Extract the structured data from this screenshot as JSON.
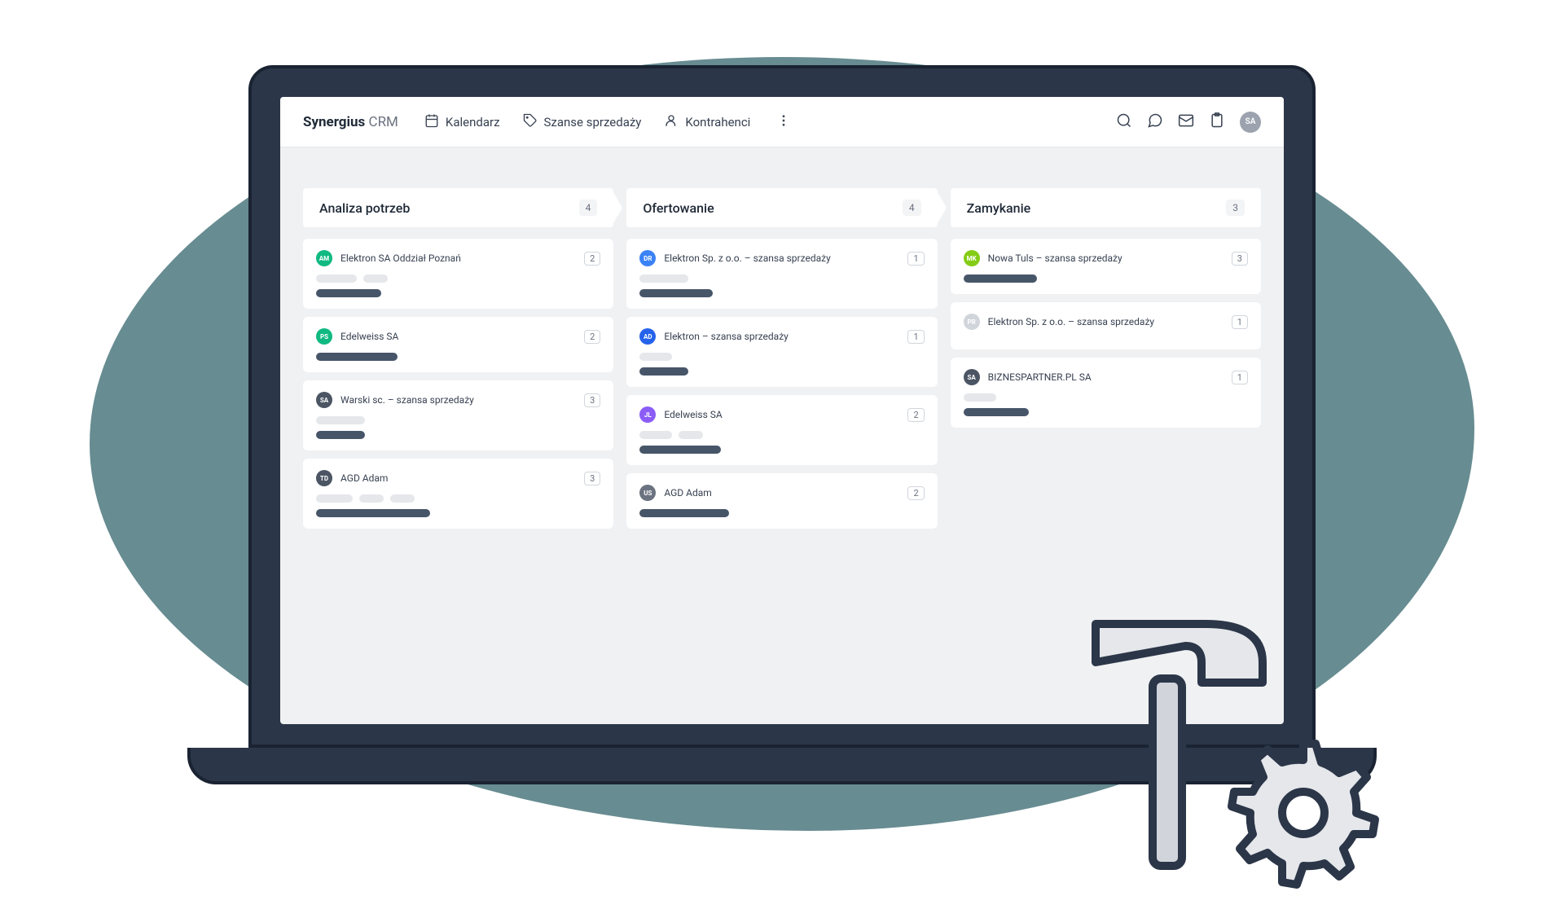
{
  "brand": {
    "name": "Synergius",
    "suffix": "CRM"
  },
  "nav": {
    "calendar": "Kalendarz",
    "opportunities": "Szanse sprzedaży",
    "contractors": "Kontrahenci"
  },
  "user_avatar": "SA",
  "columns": [
    {
      "title": "Analiza potrzeb",
      "count": "4",
      "cards": [
        {
          "avatar": "AM",
          "color": "#10b981",
          "title": "Elektron SA Oddział Poznań",
          "num": "2",
          "ph_light": [
            50,
            30
          ],
          "ph_dark": 80
        },
        {
          "avatar": "PS",
          "color": "#10b981",
          "title": "Edelweiss SA",
          "num": "2",
          "ph_light": [],
          "ph_dark": 100
        },
        {
          "avatar": "SA",
          "color": "#4b5563",
          "title": "Warski sc. – szansa sprzedaży",
          "num": "3",
          "ph_light": [
            60
          ],
          "ph_dark": 60
        },
        {
          "avatar": "TD",
          "color": "#4b5563",
          "title": "AGD Adam",
          "num": "3",
          "ph_light": [
            45,
            30,
            30
          ],
          "ph_dark": 140
        }
      ]
    },
    {
      "title": "Ofertowanie",
      "count": "4",
      "cards": [
        {
          "avatar": "DR",
          "color": "#3b82f6",
          "title": "Elektron Sp. z o.o. – szansa sprzedaży",
          "num": "1",
          "ph_light": [
            60
          ],
          "ph_dark": 90
        },
        {
          "avatar": "AD",
          "color": "#2563eb",
          "title": "Elektron – szansa sprzedaży",
          "num": "1",
          "ph_light": [
            40
          ],
          "ph_dark": 60
        },
        {
          "avatar": "JL",
          "color": "#8b5cf6",
          "title": "Edelweiss SA",
          "num": "2",
          "ph_light": [
            40,
            30
          ],
          "ph_dark": 100
        },
        {
          "avatar": "US",
          "color": "#6b7280",
          "title": "AGD Adam",
          "num": "2",
          "ph_light": [],
          "ph_dark": 110
        }
      ]
    },
    {
      "title": "Zamykanie",
      "count": "3",
      "cards": [
        {
          "avatar": "MK",
          "color": "#84cc16",
          "title": "Nowa Tuls – szansa sprzedaży",
          "num": "3",
          "ph_light": [],
          "ph_dark": 90
        },
        {
          "avatar": "PR",
          "color": "#d1d5db",
          "title": "Elektron Sp. z o.o. – szansa sprzedaży",
          "num": "1",
          "ph_light": [],
          "ph_dark": 0,
          "compact": true
        },
        {
          "avatar": "SA",
          "color": "#4b5563",
          "title": "BIZNESPARTNER.PL SA",
          "num": "1",
          "ph_light": [
            40
          ],
          "ph_dark": 80
        }
      ]
    }
  ]
}
